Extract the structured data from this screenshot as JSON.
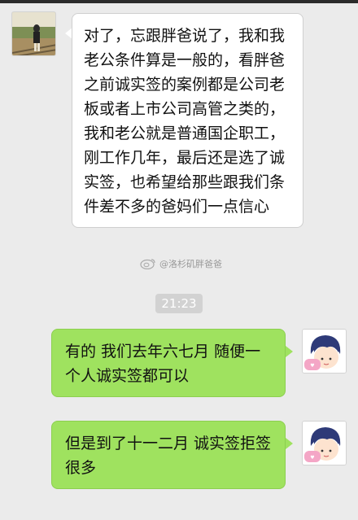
{
  "messages": [
    {
      "side": "received",
      "text": "对了，忘跟胖爸说了，我和我老公条件算是一般的，看胖爸之前诚实签的案例都是公司老板或者上市公司高管之类的，我和老公就是普通国企职工，刚工作几年，最后还是选了诚实签，也希望给那些跟我们条件差不多的爸妈们一点信心"
    },
    {
      "side": "sent",
      "text": "有的 我们去年六七月 随便一个人诚实签都可以"
    },
    {
      "side": "sent",
      "text": "但是到了十一二月 诚实签拒签很多"
    }
  ],
  "timestamp": "21:23",
  "watermark": "@洛杉矶胖爸爸"
}
